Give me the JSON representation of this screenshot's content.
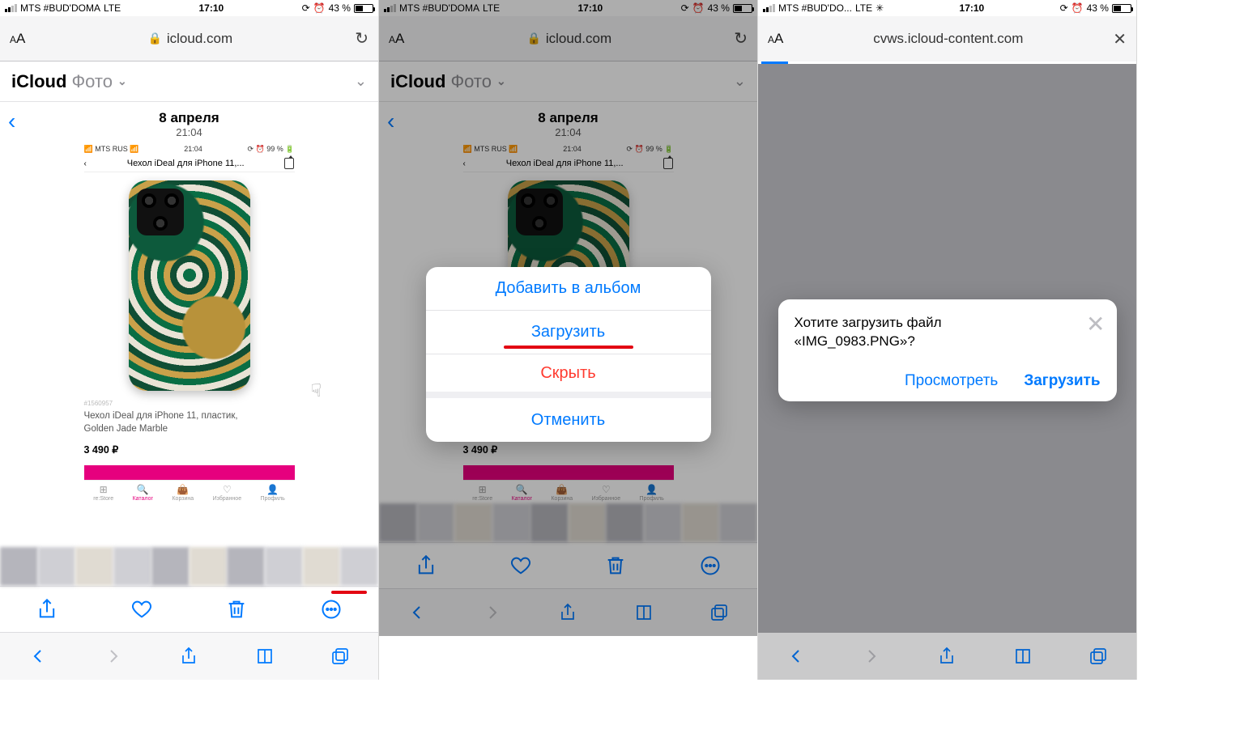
{
  "status": {
    "carrier": "MTS #BUD'DOMA",
    "carrier_short": "MTS #BUD'DO...",
    "network": "LTE",
    "time": "17:10",
    "battery_pct": "43 %",
    "alarm": "⏰",
    "rotation": "⟳"
  },
  "url_bar": {
    "domain": "icloud.com",
    "domain3": "cvws.icloud-content.com"
  },
  "icloud_header": {
    "app": "iCloud",
    "section": "Фото"
  },
  "photo_header": {
    "date": "8 апреля",
    "time": "21:04"
  },
  "inner_screenshot": {
    "top_carrier": "MTS RUS",
    "top_time": "21:04",
    "top_batt": "99 %",
    "nav_title": "Чехол iDeal для iPhone 11,...",
    "sku": "#1560957",
    "product_title_line1": "Чехол iDeal для iPhone 11, пластик,",
    "product_title_line2": "Golden Jade Marble",
    "price": "3 490 ₽",
    "tabs": {
      "t1": "re:Store",
      "t2": "Каталог",
      "t3": "Корзина",
      "t4": "Избранное",
      "t5": "Профиль"
    }
  },
  "action_sheet": {
    "add_to_album": "Добавить в альбом",
    "download": "Загрузить",
    "hide": "Скрыть",
    "cancel": "Отменить"
  },
  "dialog3": {
    "question_line1": "Хотите загрузить файл",
    "filename": "IMG_0983.PNG",
    "view": "Просмотреть",
    "download": "Загрузить"
  }
}
